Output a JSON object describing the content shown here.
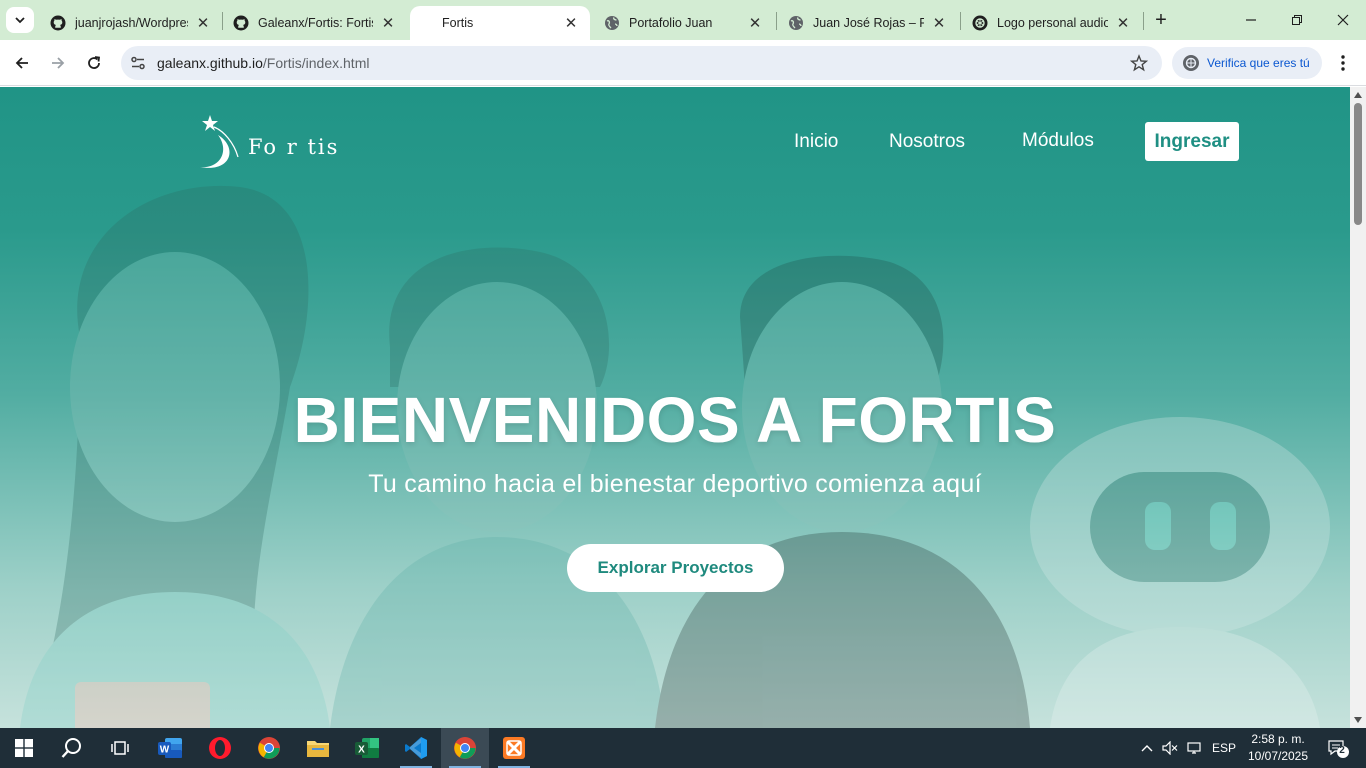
{
  "browser": {
    "tabs": [
      {
        "title": "juanjrojash/Wordpres",
        "icon": "github-icon",
        "active": false
      },
      {
        "title": "Galeanx/Fortis: Fortis",
        "icon": "github-icon",
        "active": false
      },
      {
        "title": "Fortis",
        "icon": "",
        "active": true
      },
      {
        "title": "Portafolio Juan",
        "icon": "globe-icon",
        "active": false
      },
      {
        "title": "Juan José Rojas – Por",
        "icon": "globe-icon",
        "active": false
      },
      {
        "title": "Logo personal audiov",
        "icon": "openai-icon",
        "active": false
      }
    ],
    "url_domain": "galeanx.github.io",
    "url_path": "/Fortis/index.html",
    "verify_label": "Verifica que eres tú"
  },
  "page": {
    "brand": "Fo r tis",
    "nav": [
      "Inicio",
      "Nosotros",
      "Módulos"
    ],
    "login_label": "Ingresar",
    "hero_title": "BIENVENIDOS A FORTIS",
    "hero_subtitle": "Tu camino hacia el bienestar deportivo comienza aquí",
    "hero_button": "Explorar Proyectos",
    "colors": {
      "primary": "#209486",
      "accent": "#1f8a7e"
    }
  },
  "taskbar": {
    "apps": [
      "start-icon",
      "search-icon",
      "task-view-icon",
      "word-icon",
      "opera-icon",
      "chrome-icon",
      "file-explorer-icon",
      "excel-icon",
      "vscode-icon",
      "chrome-icon",
      "xampp-icon"
    ],
    "language": "ESP",
    "time": "2:58 p. m.",
    "date": "10/07/2025",
    "notifications": "2"
  }
}
